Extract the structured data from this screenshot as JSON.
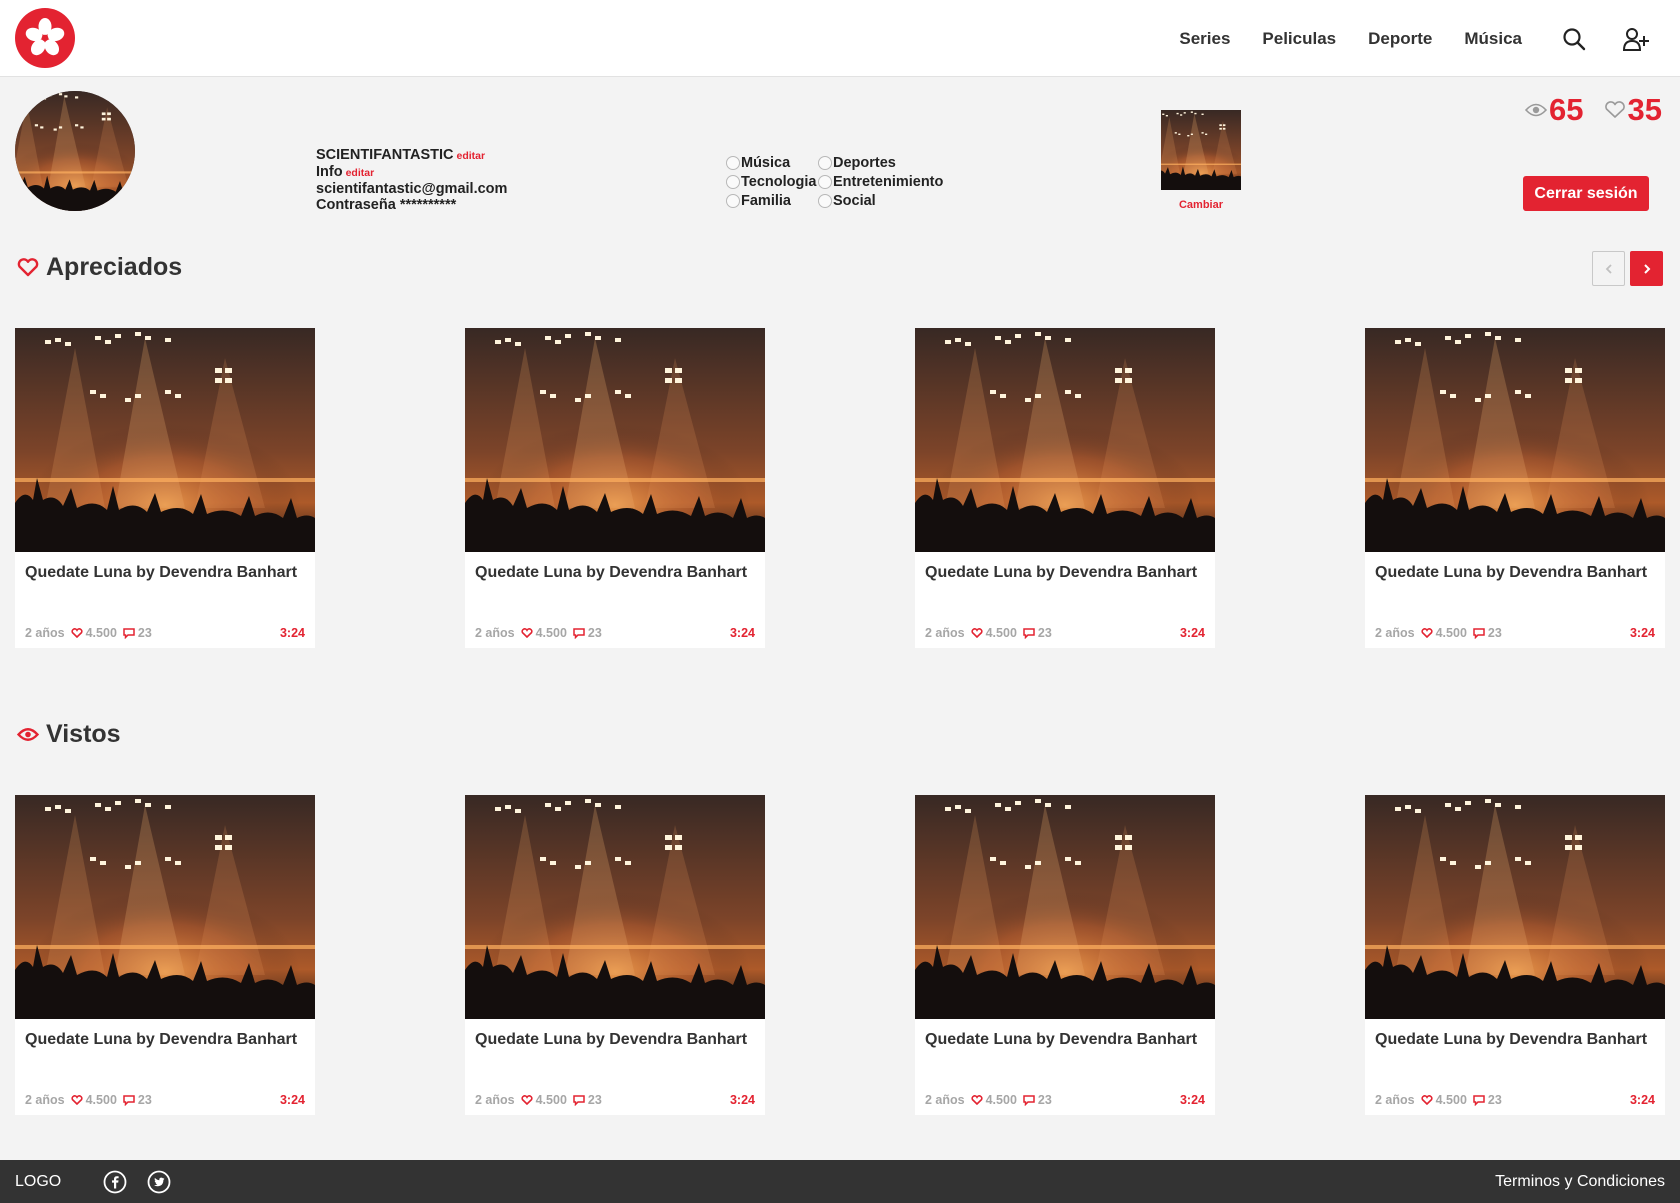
{
  "brand": {
    "accent": "#e32331",
    "footer_bg": "#333333"
  },
  "header": {
    "logo_icon": "asterisk-flower-icon",
    "nav": [
      "Series",
      "Peliculas",
      "Deporte",
      "Música"
    ],
    "icons": [
      "search-icon",
      "add-user-icon"
    ]
  },
  "profile": {
    "username": "SCIENTIFANTASTIC",
    "edit_label": "editar",
    "info_label": "Info",
    "info_edit_label": "editar",
    "email": "scientifantastic@gmail.com",
    "password_label": "Contraseña",
    "password_mask": "**********",
    "interests": [
      "Música",
      "Deportes",
      "Tecnologia",
      "Entretenimiento",
      "Familia",
      "Social"
    ],
    "change_label": "Cambiar",
    "views_count": "65",
    "likes_count": "35",
    "logout_label": "Cerrar sesión"
  },
  "sections": {
    "liked": {
      "title": "Apreciados",
      "icon": "heart-icon",
      "cards": [
        {
          "title": "Quedate Luna by Devendra Banhart",
          "age": "2 años",
          "likes": "4.500",
          "comments": "23",
          "duration": "3:24"
        },
        {
          "title": "Quedate Luna by Devendra Banhart",
          "age": "2 años",
          "likes": "4.500",
          "comments": "23",
          "duration": "3:24"
        },
        {
          "title": "Quedate Luna by Devendra Banhart",
          "age": "2 años",
          "likes": "4.500",
          "comments": "23",
          "duration": "3:24"
        },
        {
          "title": "Quedate Luna by Devendra Banhart",
          "age": "2 años",
          "likes": "4.500",
          "comments": "23",
          "duration": "3:24"
        }
      ]
    },
    "seen": {
      "title": "Vistos",
      "icon": "eye-icon",
      "cards": [
        {
          "title": "Quedate Luna by Devendra Banhart",
          "age": "2 años",
          "likes": "4.500",
          "comments": "23",
          "duration": "3:24"
        },
        {
          "title": "Quedate Luna by Devendra Banhart",
          "age": "2 años",
          "likes": "4.500",
          "comments": "23",
          "duration": "3:24"
        },
        {
          "title": "Quedate Luna by Devendra Banhart",
          "age": "2 años",
          "likes": "4.500",
          "comments": "23",
          "duration": "3:24"
        },
        {
          "title": "Quedate Luna by Devendra Banhart",
          "age": "2 años",
          "likes": "4.500",
          "comments": "23",
          "duration": "3:24"
        }
      ]
    }
  },
  "footer": {
    "logo_text": "LOGO",
    "social_icons": [
      "facebook-icon",
      "twitter-icon"
    ],
    "terms": "Terminos y Condiciones"
  }
}
